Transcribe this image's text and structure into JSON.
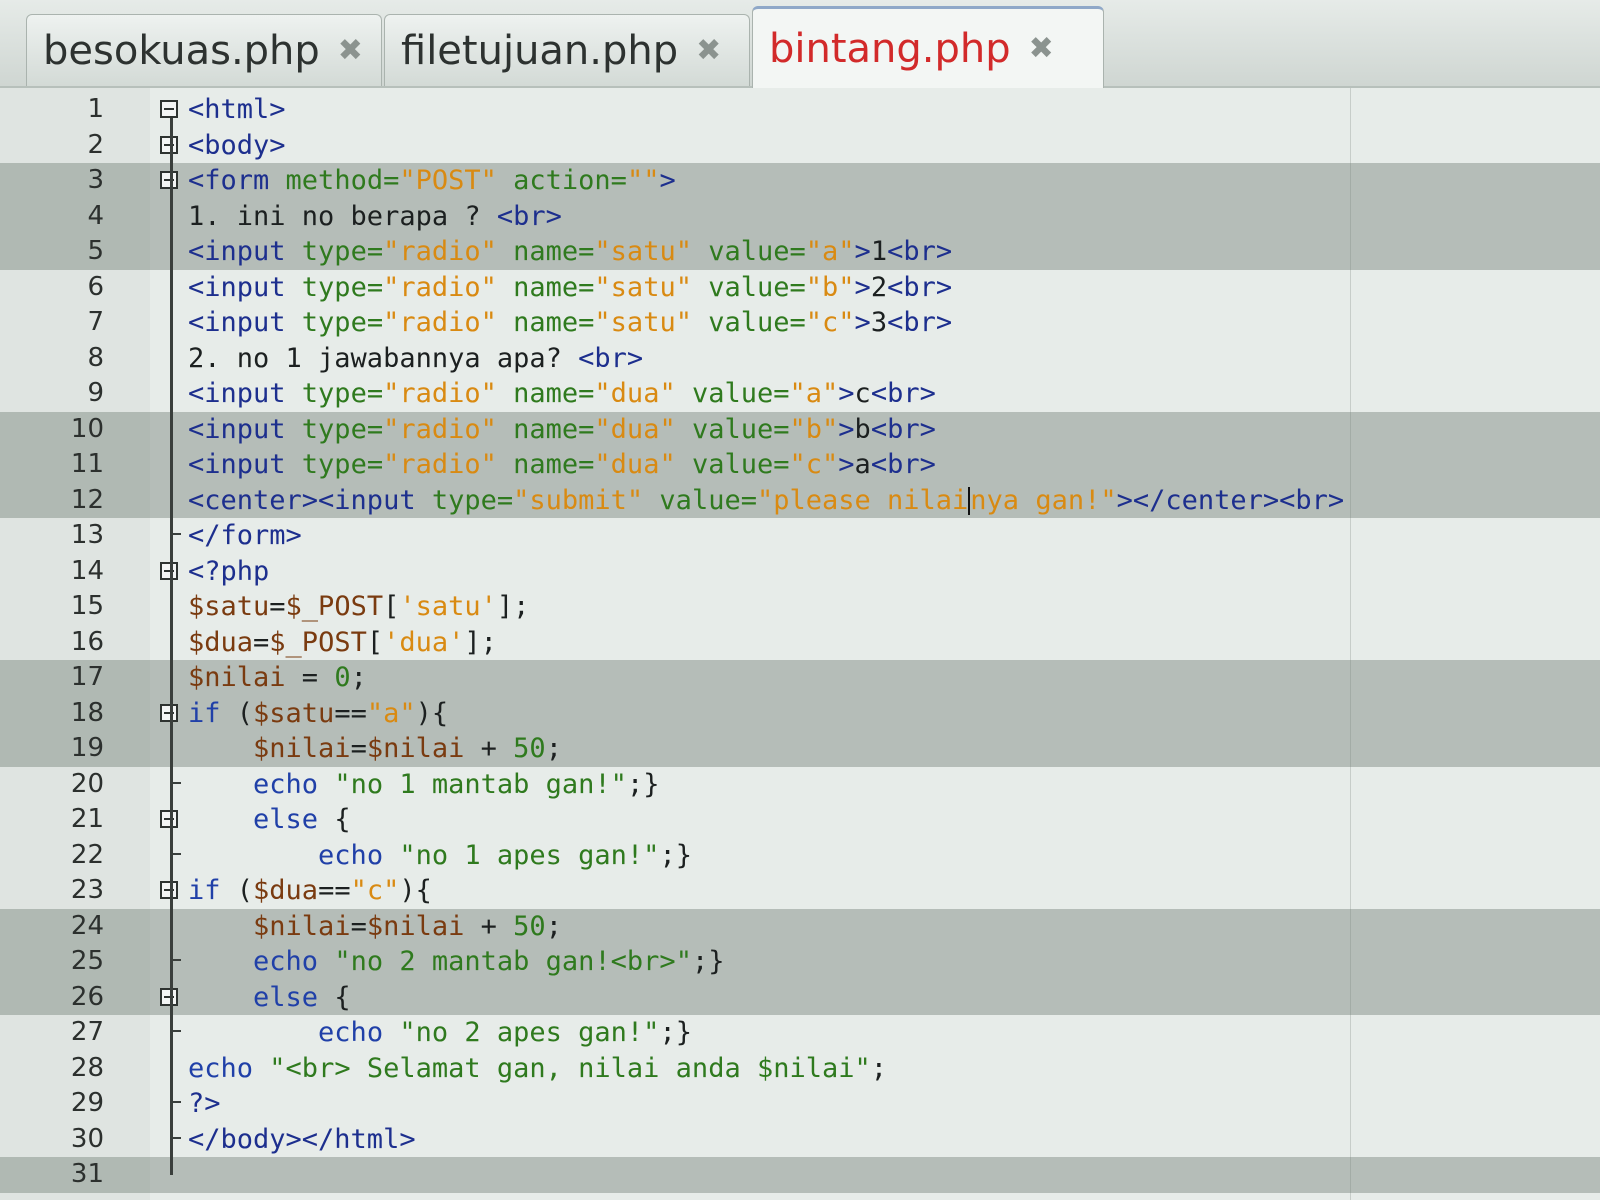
{
  "tabs": [
    {
      "label": "besokuas.php",
      "active": false
    },
    {
      "label": "filetujuan.php",
      "active": false
    },
    {
      "label": "bintang.php",
      "active": true
    }
  ],
  "close_icon": "close-icon",
  "editor": {
    "lines": [
      {
        "n": "1",
        "fold": "start",
        "shade": false,
        "tokens": [
          [
            "tag",
            "<html>"
          ]
        ]
      },
      {
        "n": "2",
        "fold": "start",
        "shade": false,
        "tokens": [
          [
            "tag",
            "<body>"
          ]
        ]
      },
      {
        "n": "3",
        "fold": "start",
        "shade": true,
        "tokens": [
          [
            "tag",
            "<form "
          ],
          [
            "attr",
            "method="
          ],
          [
            "str",
            "\"POST\""
          ],
          [
            "attr",
            " action="
          ],
          [
            "str",
            "\"\""
          ],
          [
            "tag",
            ">"
          ]
        ]
      },
      {
        "n": "4",
        "fold": "none",
        "shade": true,
        "tokens": [
          [
            "txt",
            "1. ini no berapa ? "
          ],
          [
            "tag",
            "<br>"
          ]
        ]
      },
      {
        "n": "5",
        "fold": "none",
        "shade": true,
        "tokens": [
          [
            "tag",
            "<input "
          ],
          [
            "attr",
            "type="
          ],
          [
            "str",
            "\"radio\""
          ],
          [
            "attr",
            " name="
          ],
          [
            "str",
            "\"satu\""
          ],
          [
            "attr",
            " value="
          ],
          [
            "str",
            "\"a\""
          ],
          [
            "tag",
            ">"
          ],
          [
            "txt",
            "1"
          ],
          [
            "tag",
            "<br>"
          ]
        ]
      },
      {
        "n": "6",
        "fold": "none",
        "shade": false,
        "tokens": [
          [
            "tag",
            "<input "
          ],
          [
            "attr",
            "type="
          ],
          [
            "str",
            "\"radio\""
          ],
          [
            "attr",
            " name="
          ],
          [
            "str",
            "\"satu\""
          ],
          [
            "attr",
            " value="
          ],
          [
            "str",
            "\"b\""
          ],
          [
            "tag",
            ">"
          ],
          [
            "txt",
            "2"
          ],
          [
            "tag",
            "<br>"
          ]
        ]
      },
      {
        "n": "7",
        "fold": "none",
        "shade": false,
        "tokens": [
          [
            "tag",
            "<input "
          ],
          [
            "attr",
            "type="
          ],
          [
            "str",
            "\"radio\""
          ],
          [
            "attr",
            " name="
          ],
          [
            "str",
            "\"satu\""
          ],
          [
            "attr",
            " value="
          ],
          [
            "str",
            "\"c\""
          ],
          [
            "tag",
            ">"
          ],
          [
            "txt",
            "3"
          ],
          [
            "tag",
            "<br>"
          ]
        ]
      },
      {
        "n": "8",
        "fold": "none",
        "shade": false,
        "tokens": [
          [
            "txt",
            "2. no 1 jawabannya apa? "
          ],
          [
            "tag",
            "<br>"
          ]
        ]
      },
      {
        "n": "9",
        "fold": "none",
        "shade": false,
        "tokens": [
          [
            "tag",
            "<input "
          ],
          [
            "attr",
            "type="
          ],
          [
            "str",
            "\"radio\""
          ],
          [
            "attr",
            " name="
          ],
          [
            "str",
            "\"dua\""
          ],
          [
            "attr",
            " value="
          ],
          [
            "str",
            "\"a\""
          ],
          [
            "tag",
            ">"
          ],
          [
            "txt",
            "c"
          ],
          [
            "tag",
            "<br>"
          ]
        ]
      },
      {
        "n": "10",
        "fold": "none",
        "shade": true,
        "tokens": [
          [
            "tag",
            "<input "
          ],
          [
            "attr",
            "type="
          ],
          [
            "str",
            "\"radio\""
          ],
          [
            "attr",
            " name="
          ],
          [
            "str",
            "\"dua\""
          ],
          [
            "attr",
            " value="
          ],
          [
            "str",
            "\"b\""
          ],
          [
            "tag",
            ">"
          ],
          [
            "txt",
            "b"
          ],
          [
            "tag",
            "<br>"
          ]
        ]
      },
      {
        "n": "11",
        "fold": "none",
        "shade": true,
        "tokens": [
          [
            "tag",
            "<input "
          ],
          [
            "attr",
            "type="
          ],
          [
            "str",
            "\"radio\""
          ],
          [
            "attr",
            " name="
          ],
          [
            "str",
            "\"dua\""
          ],
          [
            "attr",
            " value="
          ],
          [
            "str",
            "\"c\""
          ],
          [
            "tag",
            ">"
          ],
          [
            "txt",
            "a"
          ],
          [
            "tag",
            "<br>"
          ]
        ]
      },
      {
        "n": "12",
        "fold": "none",
        "shade": true,
        "tokens": [
          [
            "tag",
            "<center><input "
          ],
          [
            "attr",
            "type="
          ],
          [
            "str",
            "\"submit\""
          ],
          [
            "attr",
            " value="
          ],
          [
            "str",
            "\"please nilai"
          ],
          [
            "cursor",
            ""
          ],
          [
            "str",
            "nya gan!\""
          ],
          [
            "tag",
            "></center><br>"
          ]
        ]
      },
      {
        "n": "13",
        "fold": "end",
        "shade": false,
        "tokens": [
          [
            "tag",
            "</form>"
          ]
        ]
      },
      {
        "n": "14",
        "fold": "start",
        "shade": false,
        "tokens": [
          [
            "php",
            "<?php"
          ]
        ]
      },
      {
        "n": "15",
        "fold": "none",
        "shade": false,
        "tokens": [
          [
            "var",
            "$satu"
          ],
          [
            "txt",
            "="
          ],
          [
            "var",
            "$_POST"
          ],
          [
            "txt",
            "["
          ],
          [
            "str",
            "'satu'"
          ],
          [
            "txt",
            "];"
          ]
        ]
      },
      {
        "n": "16",
        "fold": "none",
        "shade": false,
        "tokens": [
          [
            "var",
            "$dua"
          ],
          [
            "txt",
            "="
          ],
          [
            "var",
            "$_POST"
          ],
          [
            "txt",
            "["
          ],
          [
            "str",
            "'dua'"
          ],
          [
            "txt",
            "];"
          ]
        ]
      },
      {
        "n": "17",
        "fold": "none",
        "shade": true,
        "tokens": [
          [
            "var",
            "$nilai"
          ],
          [
            "txt",
            " = "
          ],
          [
            "num",
            "0"
          ],
          [
            "txt",
            ";"
          ]
        ]
      },
      {
        "n": "18",
        "fold": "start",
        "shade": true,
        "tokens": [
          [
            "kw",
            "if"
          ],
          [
            "txt",
            " ("
          ],
          [
            "var",
            "$satu"
          ],
          [
            "txt",
            "=="
          ],
          [
            "str",
            "\"a\""
          ],
          [
            "txt",
            "){"
          ]
        ]
      },
      {
        "n": "19",
        "fold": "none",
        "shade": true,
        "tokens": [
          [
            "txt",
            "    "
          ],
          [
            "var",
            "$nilai"
          ],
          [
            "txt",
            "="
          ],
          [
            "var",
            "$nilai"
          ],
          [
            "txt",
            " + "
          ],
          [
            "num",
            "50"
          ],
          [
            "txt",
            ";"
          ]
        ]
      },
      {
        "n": "20",
        "fold": "end",
        "shade": false,
        "tokens": [
          [
            "txt",
            "    "
          ],
          [
            "kw",
            "echo"
          ],
          [
            "txt",
            " "
          ],
          [
            "grn",
            "\"no 1 mantab gan!\""
          ],
          [
            "txt",
            ";}"
          ]
        ]
      },
      {
        "n": "21",
        "fold": "start",
        "shade": false,
        "tokens": [
          [
            "txt",
            "    "
          ],
          [
            "kw",
            "else"
          ],
          [
            "txt",
            " {"
          ]
        ]
      },
      {
        "n": "22",
        "fold": "end",
        "shade": false,
        "tokens": [
          [
            "txt",
            "        "
          ],
          [
            "kw",
            "echo"
          ],
          [
            "txt",
            " "
          ],
          [
            "grn",
            "\"no 1 apes gan!\""
          ],
          [
            "txt",
            ";}"
          ]
        ]
      },
      {
        "n": "23",
        "fold": "start",
        "shade": false,
        "tokens": [
          [
            "kw",
            "if"
          ],
          [
            "txt",
            " ("
          ],
          [
            "var",
            "$dua"
          ],
          [
            "txt",
            "=="
          ],
          [
            "str",
            "\"c\""
          ],
          [
            "txt",
            "){"
          ]
        ]
      },
      {
        "n": "24",
        "fold": "none",
        "shade": true,
        "tokens": [
          [
            "txt",
            "    "
          ],
          [
            "var",
            "$nilai"
          ],
          [
            "txt",
            "="
          ],
          [
            "var",
            "$nilai"
          ],
          [
            "txt",
            " + "
          ],
          [
            "num",
            "50"
          ],
          [
            "txt",
            ";"
          ]
        ]
      },
      {
        "n": "25",
        "fold": "end",
        "shade": true,
        "tokens": [
          [
            "txt",
            "    "
          ],
          [
            "kw",
            "echo"
          ],
          [
            "txt",
            " "
          ],
          [
            "grn",
            "\"no 2 mantab gan!<br>\""
          ],
          [
            "txt",
            ";}"
          ]
        ]
      },
      {
        "n": "26",
        "fold": "start",
        "shade": true,
        "tokens": [
          [
            "txt",
            "    "
          ],
          [
            "kw",
            "else"
          ],
          [
            "txt",
            " {"
          ]
        ]
      },
      {
        "n": "27",
        "fold": "end",
        "shade": false,
        "tokens": [
          [
            "txt",
            "        "
          ],
          [
            "kw",
            "echo"
          ],
          [
            "txt",
            " "
          ],
          [
            "grn",
            "\"no 2 apes gan!\""
          ],
          [
            "txt",
            ";}"
          ]
        ]
      },
      {
        "n": "28",
        "fold": "none",
        "shade": false,
        "tokens": [
          [
            "kw",
            "echo"
          ],
          [
            "txt",
            " "
          ],
          [
            "grn",
            "\"<br> Selamat gan, nilai anda $nilai\""
          ],
          [
            "txt",
            ";"
          ]
        ]
      },
      {
        "n": "29",
        "fold": "end",
        "shade": false,
        "tokens": [
          [
            "php",
            "?>"
          ]
        ]
      },
      {
        "n": "30",
        "fold": "end",
        "shade": false,
        "tokens": [
          [
            "tag",
            "</body></html>"
          ]
        ]
      },
      {
        "n": "31",
        "fold": "none",
        "shade": true,
        "tokens": []
      }
    ]
  },
  "colors": {
    "tag": "#1d2f8e",
    "attribute": "#2f7a1e",
    "string": "#d98a12",
    "active_tab": "#d22a2a"
  }
}
